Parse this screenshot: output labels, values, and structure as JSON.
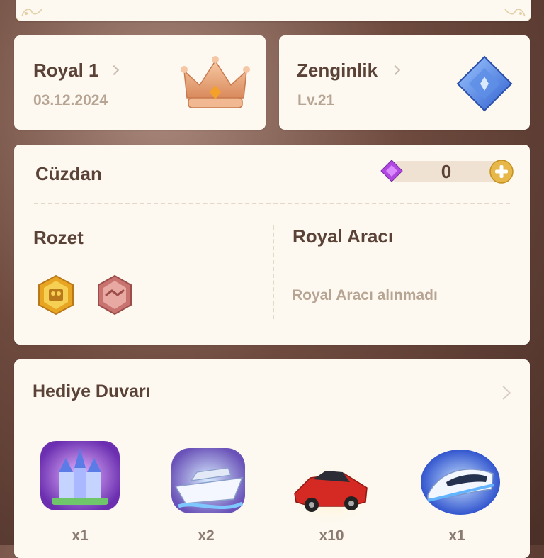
{
  "royal": {
    "title": "Royal 1",
    "date": "03.12.2024",
    "icon": "crown-icon"
  },
  "wealth": {
    "title": "Zenginlik",
    "level": "Lv.21",
    "icon": "diamond-badge-icon"
  },
  "wallet": {
    "title": "Cüzdan",
    "balance": "0",
    "currency_icon": "purple-gem-icon",
    "add_icon": "plus-icon"
  },
  "badges": {
    "title": "Rozet",
    "items": [
      "gold-hexagon-badge",
      "pink-handshake-badge"
    ]
  },
  "royal_vehicle": {
    "title": "Royal Aracı",
    "empty_text": "Royal Aracı alınmadı"
  },
  "gift_wall": {
    "title": "Hediye Duvarı",
    "items": [
      {
        "name": "castle-gift",
        "count": "x1"
      },
      {
        "name": "yacht-gift",
        "count": "x2"
      },
      {
        "name": "sports-car-gift",
        "count": "x10"
      },
      {
        "name": "bullet-train-gift",
        "count": "x1"
      }
    ]
  },
  "colors": {
    "card_bg": "#fdf9f1",
    "title": "#5a4236",
    "muted": "#b7a493",
    "gold": "#e7b74a"
  }
}
